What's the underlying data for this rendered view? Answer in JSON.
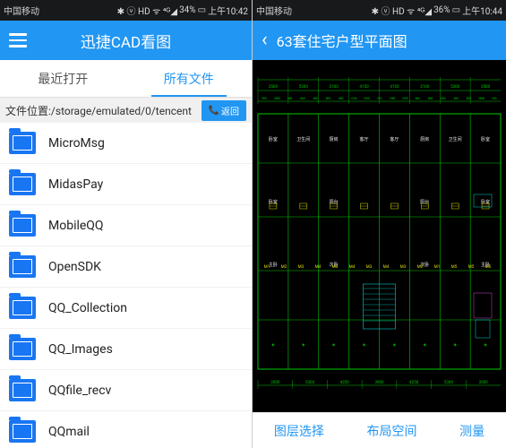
{
  "left": {
    "status": {
      "carrier": "中国移动",
      "battery": "34%",
      "time": "上午10:42",
      "icons": "✱ ⓥ HD ᯤ ⁴ᴳ◢"
    },
    "header": {
      "title": "迅捷CAD看图"
    },
    "tabs": {
      "recent": "最近打开",
      "all": "所有文件"
    },
    "path": {
      "prefix": "文件位置:",
      "value": "/storage/emulated/0/tencent",
      "back": "返回"
    },
    "folders": [
      {
        "name": "MicroMsg"
      },
      {
        "name": "MidasPay"
      },
      {
        "name": "MobileQQ"
      },
      {
        "name": "OpenSDK"
      },
      {
        "name": "QQ_Collection"
      },
      {
        "name": "QQ_Images"
      },
      {
        "name": "QQfile_recv"
      },
      {
        "name": "QQmail"
      }
    ]
  },
  "right": {
    "status": {
      "carrier": "中国移动",
      "battery": "36%",
      "time": "上午10:44",
      "icons": "✱ ⓥ HD ᯤ ⁴ᴳ◢"
    },
    "header": {
      "title": "63套住宅户型平面图"
    },
    "actions": {
      "layer": "图层选择",
      "layout": "布局空间",
      "measure": "测量"
    },
    "cad": {
      "top_dims": [
        "3500",
        "5300",
        "2100",
        "4150",
        "4150",
        "2100",
        "5300",
        "3500"
      ],
      "sub_dims": [
        "900",
        "2600",
        "800",
        "860",
        "480",
        "800",
        "860",
        "1350",
        "1560",
        "475",
        "1560",
        "1350",
        "860",
        "800",
        "860",
        "480",
        "800",
        "2600",
        "900"
      ],
      "rooms": [
        "卧室",
        "卫生间",
        "厨房",
        "客厅",
        "客厅",
        "厨房",
        "卫生间",
        "卧室",
        "卧室",
        "阳台",
        "阳台",
        "卧室",
        "主卧",
        "次卧",
        "次卧",
        "主卧"
      ],
      "m_labels": [
        "M1",
        "M2",
        "M3",
        "M4",
        "M3",
        "M4",
        "M3",
        "M4",
        "M3",
        "M2",
        "M1",
        "M5",
        "M5",
        "M6"
      ],
      "bot_dims": [
        "3500",
        "5300",
        "4250",
        "3900",
        "4250",
        "5300",
        "3500"
      ]
    }
  }
}
